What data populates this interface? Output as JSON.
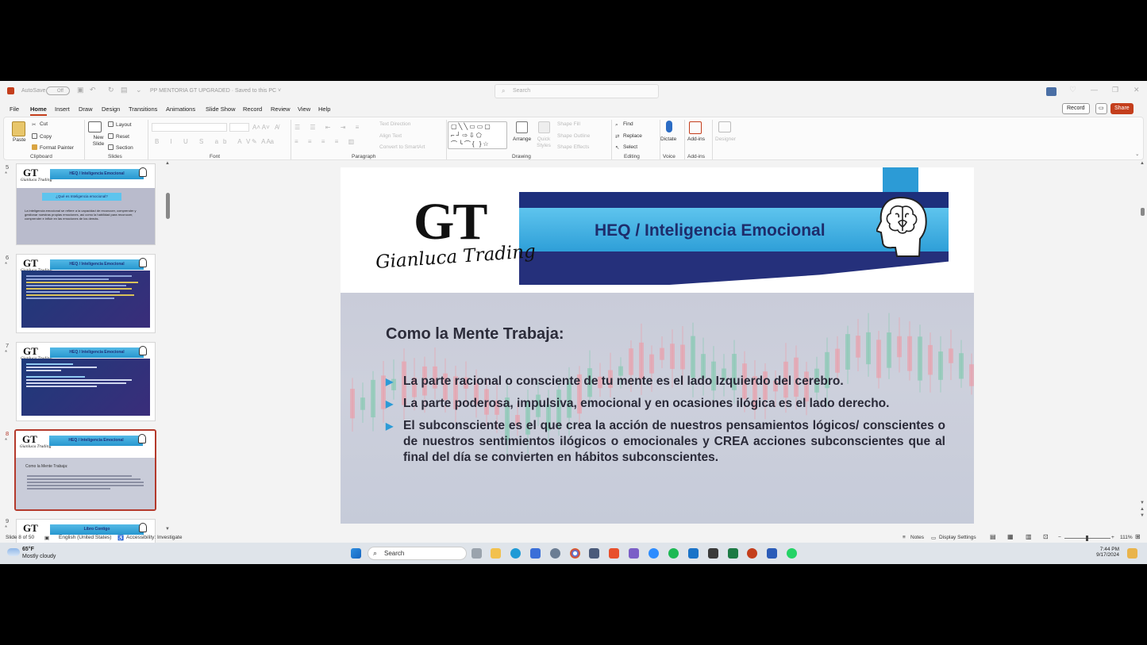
{
  "titlebar": {
    "autosave_label": "AutoSave",
    "autosave_state": "Off",
    "document_title": "PP MENTORIA GT UPGRADED · Saved to this PC ˅",
    "search_placeholder": "Search"
  },
  "menu_tabs": [
    "File",
    "Home",
    "Insert",
    "Draw",
    "Design",
    "Transitions",
    "Animations",
    "Slide Show",
    "Record",
    "Review",
    "View",
    "Help"
  ],
  "active_tab": "Home",
  "actions": {
    "record": "Record",
    "share": "Share"
  },
  "ribbon": {
    "clipboard": {
      "paste": "Paste",
      "cut": "Cut",
      "copy": "Copy",
      "format_painter": "Format Painter",
      "group": "Clipboard"
    },
    "slides": {
      "new_slide": "New Slide",
      "layout": "Layout",
      "reset": "Reset",
      "section": "Section",
      "group": "Slides"
    },
    "font": {
      "group": "Font"
    },
    "paragraph": {
      "text_direction": "Text Direction",
      "align_text": "Align Text",
      "smartart": "Convert to SmartArt",
      "group": "Paragraph"
    },
    "drawing": {
      "arrange": "Arrange",
      "quick_styles": "Quick Styles",
      "shape_fill": "Shape Fill",
      "shape_outline": "Shape Outline",
      "shape_effects": "Shape Effects",
      "group": "Drawing"
    },
    "editing": {
      "find": "Find",
      "replace": "Replace",
      "select": "Select",
      "group": "Editing"
    },
    "voice": {
      "dictate": "Dictate",
      "group": "Voice"
    },
    "addins": {
      "addins": "Add-ins",
      "designer": "Designer",
      "group": "Add-ins"
    }
  },
  "thumbnails": [
    {
      "num": "5",
      "title": "HEQ / Inteligencia Emocional",
      "sub": "¿Qué es Inteligencia emocional?",
      "body": "La inteligencia emocional se refiere a la capacidad de reconocer, comprender y gestionar nuestras propias emociones, así como la habilidad para reconocer, comprender e influir en las emociones de los demás."
    },
    {
      "num": "6",
      "title": "HEQ / Inteligencia Emocional"
    },
    {
      "num": "7",
      "title": "HEQ / Inteligencia Emocional"
    },
    {
      "num": "8",
      "title": "HEQ / Inteligencia Emocional",
      "sub": "Como la Mente Trabaja:"
    },
    {
      "num": "9",
      "title": "Libro Contigo"
    }
  ],
  "slide": {
    "logo": "GT",
    "logo_sub": "Gianluca Trading",
    "banner_title": "HEQ / Inteligencia Emocional",
    "body_title": "Como la Mente Trabaja:",
    "bullets": [
      "La parte racional o consciente de tu mente es el lado Izquierdo del cerebro.",
      "La parte poderosa, impulsiva, emocional y en ocasiones ilógica es el lado derecho.",
      "El subconsciente es el que crea  la acción de nuestros pensamientos lógicos/ conscientes o de nuestros sentimientos ilógicos o emocionales y CREA acciones subconscientes que al final del día se convierten en hábitos subconscientes."
    ]
  },
  "statusbar": {
    "slide_count": "Slide 8 of 50",
    "language": "English (United States)",
    "accessibility": "Accessibility: Investigate",
    "notes": "Notes",
    "display_settings": "Display Settings",
    "zoom": "111%"
  },
  "taskbar": {
    "temp": "65°F",
    "weather": "Mostly cloudy",
    "search": "Search",
    "time": "7:44 PM",
    "date": "9/17/2024"
  },
  "colors": {
    "accent": "#c43e1c",
    "banner_light": "#2c9bd6",
    "banner_dark": "#1d2f7c"
  }
}
